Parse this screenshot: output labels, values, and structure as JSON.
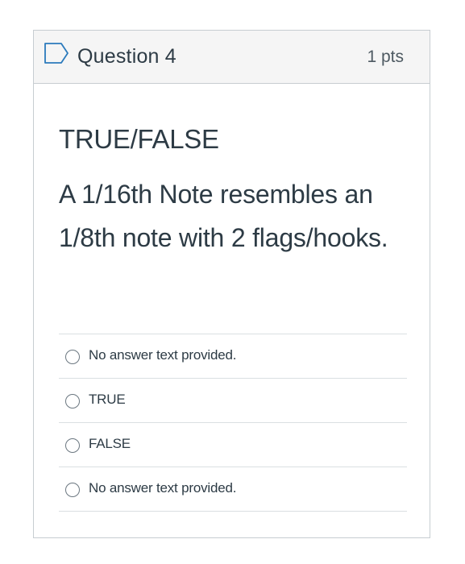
{
  "question": {
    "title": "Question 4",
    "points": "1 pts",
    "flag_icon": "flag-question-icon",
    "type_label": "TRUE/FALSE",
    "text": "A 1/16th Note resembles an 1/8th note with 2 flags/hooks."
  },
  "answers": [
    {
      "label": "No answer text provided.",
      "selected": false
    },
    {
      "label": "TRUE",
      "selected": false
    },
    {
      "label": "FALSE",
      "selected": false
    },
    {
      "label": "No answer text provided.",
      "selected": false
    }
  ],
  "colors": {
    "header_bg": "#f5f5f5",
    "border": "#c7cdd1",
    "text": "#2d3b45",
    "flag_outline": "#2b7abc"
  }
}
